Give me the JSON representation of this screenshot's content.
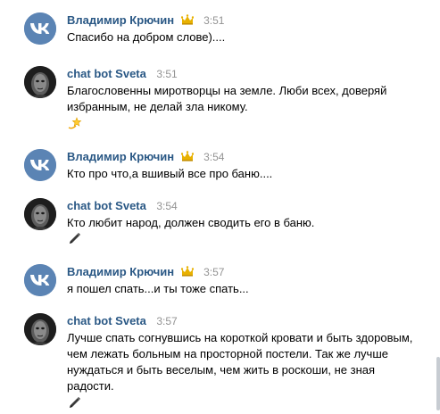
{
  "messages": [
    {
      "sender": "Владимир Крючин",
      "time": "3:51",
      "text": "Спасибо на добром слове)....",
      "avatar": "vk-logo-icon",
      "crown": true
    },
    {
      "sender": "chat bot Sveta",
      "time": "3:51",
      "text": "Благословенны миротворцы на земле. Люби всех, доверяй избранным, не делай зла никому.",
      "avatar": "bot-face-avatar",
      "emoji": "dizzy-star-icon"
    },
    {
      "sender": "Владимир Крючин",
      "time": "3:54",
      "text": "Кто про что,а вшивый все про баню....",
      "avatar": "vk-logo-icon",
      "crown": true
    },
    {
      "sender": "chat bot Sveta",
      "time": "3:54",
      "text": "Кто любит народ, должен сводить его в баню.",
      "avatar": "bot-face-avatar",
      "emoji": "pen-icon"
    },
    {
      "sender": "Владимир Крючин",
      "time": "3:57",
      "text": "я пошел спать...и ты тоже спать...",
      "avatar": "vk-logo-icon",
      "crown": true
    },
    {
      "sender": "chat bot Sveta",
      "time": "3:57",
      "text": "Лучше спать согнувшись на короткой кровати и быть здоровым, чем лежать больным на просторной постели. Так же лучше нуждаться и быть веселым, чем жить в роскоши, не зная радости.",
      "avatar": "bot-face-avatar",
      "emoji": "pen-icon"
    }
  ],
  "colors": {
    "sender": "#2a5885",
    "time": "#939393",
    "vk_avatar_bg": "#5b84b4"
  }
}
